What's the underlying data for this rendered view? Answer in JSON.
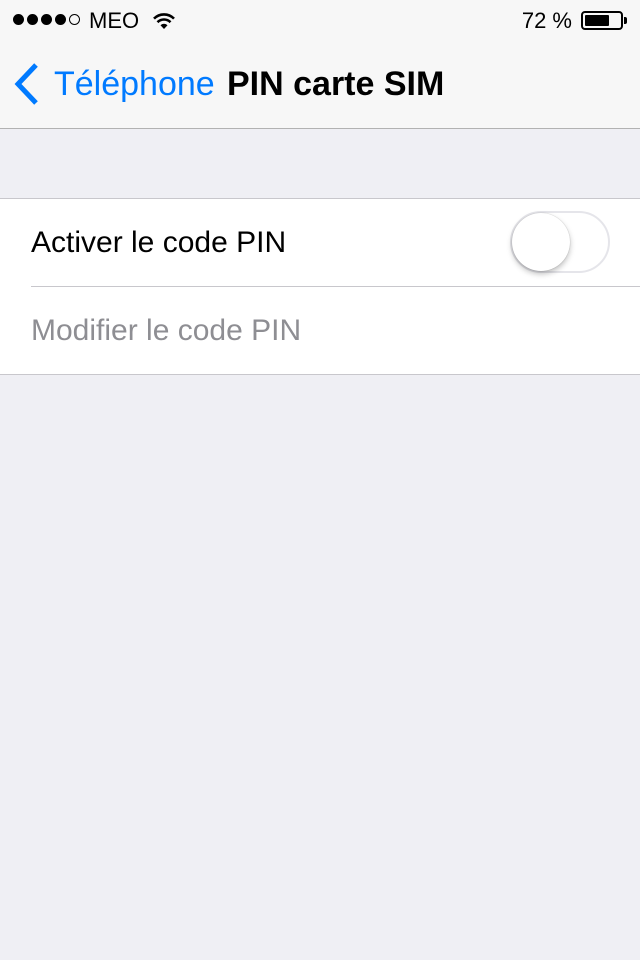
{
  "status_bar": {
    "signal_bars_filled": 4,
    "signal_bars_total": 5,
    "carrier": "MEO",
    "wifi_icon": "wifi-icon",
    "battery_percent_text": "72 %",
    "battery_level": 0.72
  },
  "nav": {
    "back_label": "Téléphone",
    "back_icon": "chevron-left-icon",
    "title": "PIN carte SIM",
    "accent_color": "#007aff"
  },
  "settings": {
    "enable_pin": {
      "label": "Activer le code PIN",
      "toggle_on": false
    },
    "change_pin": {
      "label": "Modifier le code PIN",
      "enabled": false
    }
  }
}
